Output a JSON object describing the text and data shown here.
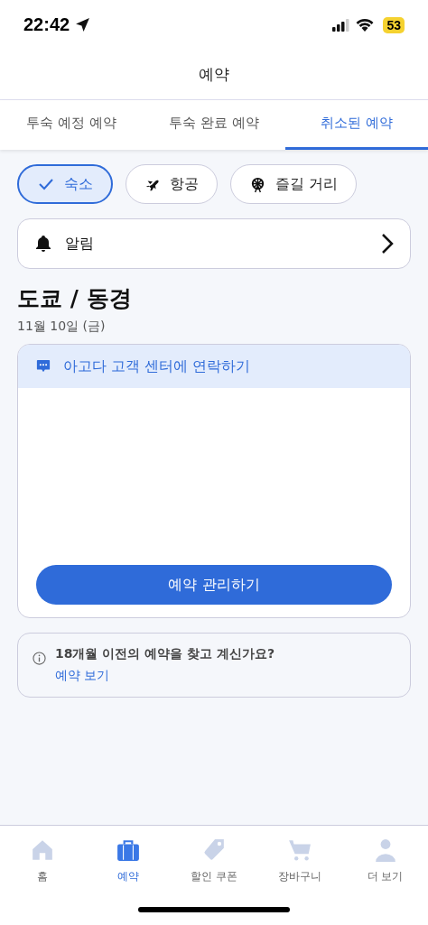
{
  "status_bar": {
    "time": "22:42",
    "battery": "53"
  },
  "header": {
    "title": "예약"
  },
  "tabs": [
    {
      "label": "투숙 예정 예약",
      "selected": false
    },
    {
      "label": "투숙 완료 예약",
      "selected": false
    },
    {
      "label": "취소된 예약",
      "selected": true
    }
  ],
  "filters": [
    {
      "kind": "check",
      "label": "숙소",
      "selected": true
    },
    {
      "kind": "plane",
      "label": "항공",
      "selected": false
    },
    {
      "kind": "ferris",
      "label": "즐길 거리",
      "selected": false
    }
  ],
  "alert_row": {
    "label": "알림"
  },
  "booking": {
    "city": "도쿄 / 동경",
    "date": "11월 10일 (금)",
    "contact": "아고다 고객 센터에 연락하기",
    "manage_button": "예약 관리하기"
  },
  "info": {
    "text": "18개월 이전의 예약을 찾고 계신가요?",
    "link": "예약 보기"
  },
  "bottom_nav": [
    {
      "kind": "home",
      "label": "홈",
      "selected": false
    },
    {
      "kind": "bag",
      "label": "예약",
      "selected": true
    },
    {
      "kind": "tag",
      "label": "할인 쿠폰",
      "selected": false
    },
    {
      "kind": "cart",
      "label": "장바구니",
      "selected": false
    },
    {
      "kind": "person",
      "label": "더 보기",
      "selected": false
    }
  ]
}
